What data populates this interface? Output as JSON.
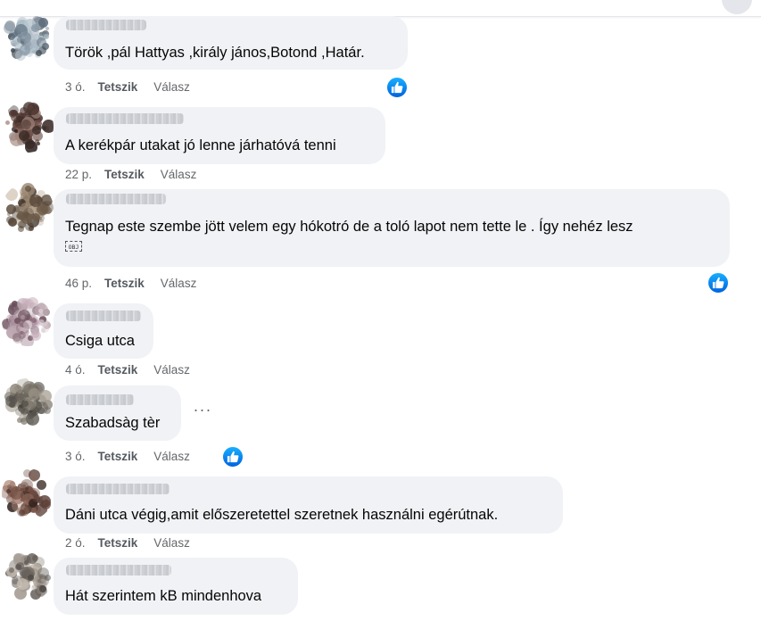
{
  "comments": [
    {
      "text": "Török ,pál Hattyas ,király jános,Botond ,Határ.",
      "time": "3 ó.",
      "like": "Tetszik",
      "reply": "Válasz",
      "reaction": "like-reaction-icon"
    },
    {
      "text": "A kerékpár utakat jó lenne járhatóvá tenni",
      "time": "22 p.",
      "like": "Tetszik",
      "reply": "Válasz"
    },
    {
      "text": "Tegnap este szembe jött velem egy hókotró de a toló lapot nem tette le . Így nehéz lesz",
      "emoji": "OBJ",
      "time": "46 p.",
      "like": "Tetszik",
      "reply": "Válasz",
      "reaction": "like-reaction-icon"
    },
    {
      "text": "Csiga utca",
      "time": "4 ó.",
      "like": "Tetszik",
      "reply": "Válasz"
    },
    {
      "text": "Szabadsàg tèr",
      "time": "3 ó.",
      "like": "Tetszik",
      "reply": "Válasz",
      "reaction": "like-reaction-icon",
      "more": "···"
    },
    {
      "text": "Dáni utca végig,amit előszeretettel szeretnek használni egérútnak.",
      "time": "2 ó.",
      "like": "Tetszik",
      "reply": "Válasz"
    },
    {
      "text": "Hát szerintem kB mindenhova"
    }
  ],
  "colors": {
    "bubble": "#f0f2f5",
    "meta_text": "#65676b",
    "like_blue": "#0866ff"
  }
}
